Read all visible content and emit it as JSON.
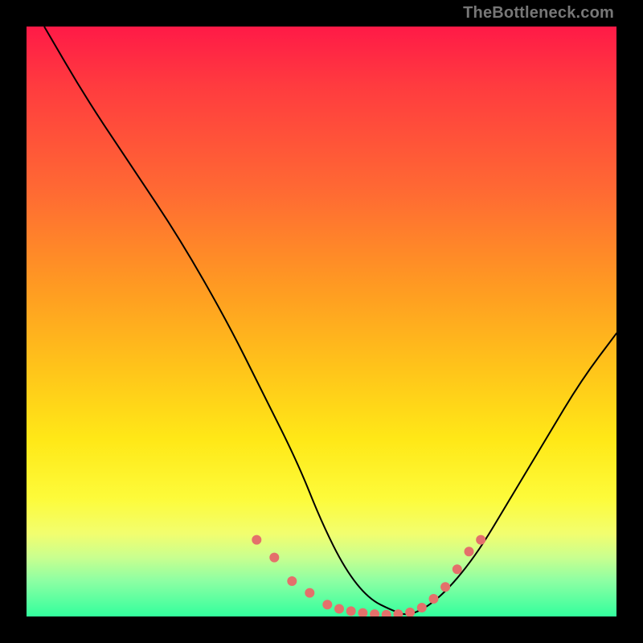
{
  "watermark": "TheBottleneck.com",
  "colors": {
    "page_bg": "#000000",
    "curve_stroke": "#000000",
    "marker_fill": "#e4706b",
    "gradient_stops": [
      "#ff1a47",
      "#ff3b3f",
      "#ff6a33",
      "#ff9a22",
      "#ffc41a",
      "#ffe817",
      "#fdfb3a",
      "#f2fe6f",
      "#c9ff8f",
      "#8cffa3",
      "#33ff9d"
    ]
  },
  "chart_data": {
    "type": "line",
    "title": "",
    "xlabel": "",
    "ylabel": "",
    "xlim": [
      0,
      100
    ],
    "ylim": [
      0,
      100
    ],
    "grid": false,
    "legend": false,
    "series": [
      {
        "name": "bottleneck-curve",
        "x": [
          3,
          10,
          18,
          26,
          34,
          40,
          46,
          50,
          54,
          58,
          62,
          65,
          70,
          76,
          82,
          88,
          94,
          100
        ],
        "values": [
          100,
          88,
          76,
          64,
          50,
          38,
          26,
          16,
          8,
          3,
          1,
          0,
          3,
          10,
          20,
          30,
          40,
          48
        ]
      }
    ],
    "markers": {
      "name": "highlighted-points",
      "x": [
        39,
        42,
        45,
        48,
        51,
        53,
        55,
        57,
        59,
        61,
        63,
        65,
        67,
        69,
        71,
        73,
        75,
        77
      ],
      "values": [
        13,
        10,
        6,
        4,
        2,
        1.3,
        0.9,
        0.6,
        0.4,
        0.3,
        0.4,
        0.7,
        1.5,
        3,
        5,
        8,
        11,
        13
      ]
    }
  }
}
